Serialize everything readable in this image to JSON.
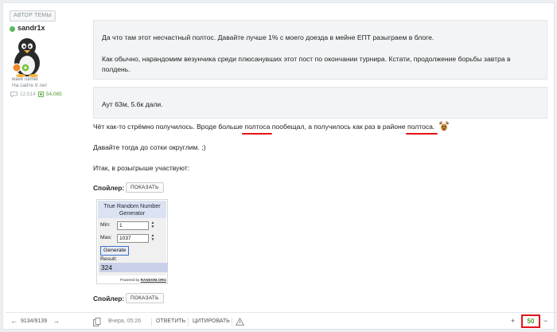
{
  "author": {
    "badge": "АВТОР ТЕМЫ",
    "name": "sandr1x",
    "rank": "wave runner",
    "member_since": "На сайте 9 лет",
    "posts_count": "12,514",
    "reputation": "54,065"
  },
  "quotes": [
    {
      "lines": [
        "Да что там этот несчастный полтос. Давайте лучше 1% с моего доезда в мейне ЕПТ разыграем в блоге.",
        "",
        "Как обычно, нарандомим везунчика среди плюсанувших этот пост по окончании турнира. Кстати, продолжение борьбы завтра в",
        "полдень."
      ]
    },
    {
      "lines": [
        "Аут 63м, 5.6к дали."
      ]
    }
  ],
  "body": {
    "line1_part1": "Чёт как-то стрёмно получилось. Вроде больше ",
    "line1_part2": "полтоса",
    "line1_part3": " пообещал, а получилось как раз в районе ",
    "line1_part4": "полтоса.",
    "line2": "Давайте тогда до сотки округлим. ;)",
    "line3": "Итак, в розыгрыше участвуют:"
  },
  "spoilers": [
    {
      "label": "Спойлер:",
      "button": "ПОКАЗАТЬ"
    },
    {
      "label": "Спойлер:",
      "button": "ПОКАЗАТЬ"
    }
  ],
  "rng": {
    "title": "True Random Number Generator",
    "min_label": "Min:",
    "min_value": "1",
    "max_label": "Max:",
    "max_value": "1037",
    "generate_label": "Generate",
    "result_label": "Result:",
    "result_value": "324",
    "powered_prefix": "Powered by",
    "powered_link": "RANDOM.ORG"
  },
  "footer": {
    "pagination": "9134/9139",
    "timestamp": "Вчера, 05:26",
    "reply": "ОТВЕТИТЬ",
    "quote": "ЦИТИРОВАТЬ",
    "vote_plus": "+",
    "vote_score": "50",
    "vote_minus": "−"
  },
  "icons": {
    "left_arrow": "arrow-left-icon",
    "right_arrow": "arrow-right-icon",
    "copy": "copy-icon",
    "report": "warning-icon",
    "emoticon": "deer-emoticon-icon"
  },
  "colors": {
    "online": "#5cb85c",
    "reputation": "#4e9a2a",
    "highlight": "#e2131a"
  }
}
